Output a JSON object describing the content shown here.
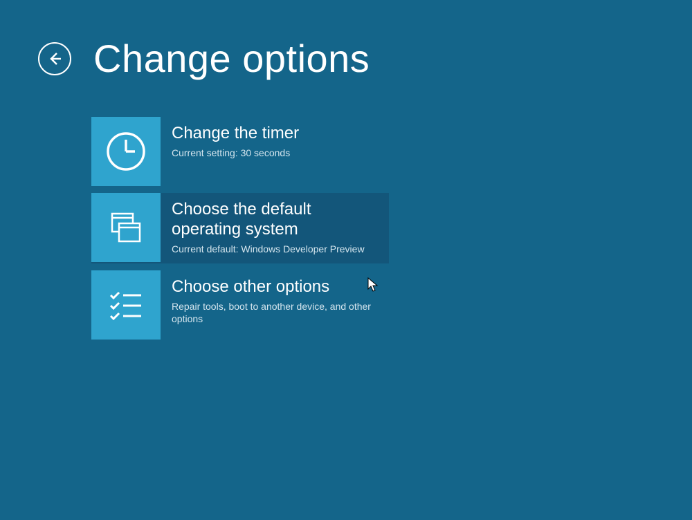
{
  "header": {
    "title": "Change options"
  },
  "options": [
    {
      "title": "Change the timer",
      "subtitle": "Current setting: 30 seconds"
    },
    {
      "title": "Choose the default operating system",
      "subtitle": "Current default: Windows Developer Preview"
    },
    {
      "title": "Choose other options",
      "subtitle": "Repair tools, boot to another device, and other options"
    }
  ]
}
